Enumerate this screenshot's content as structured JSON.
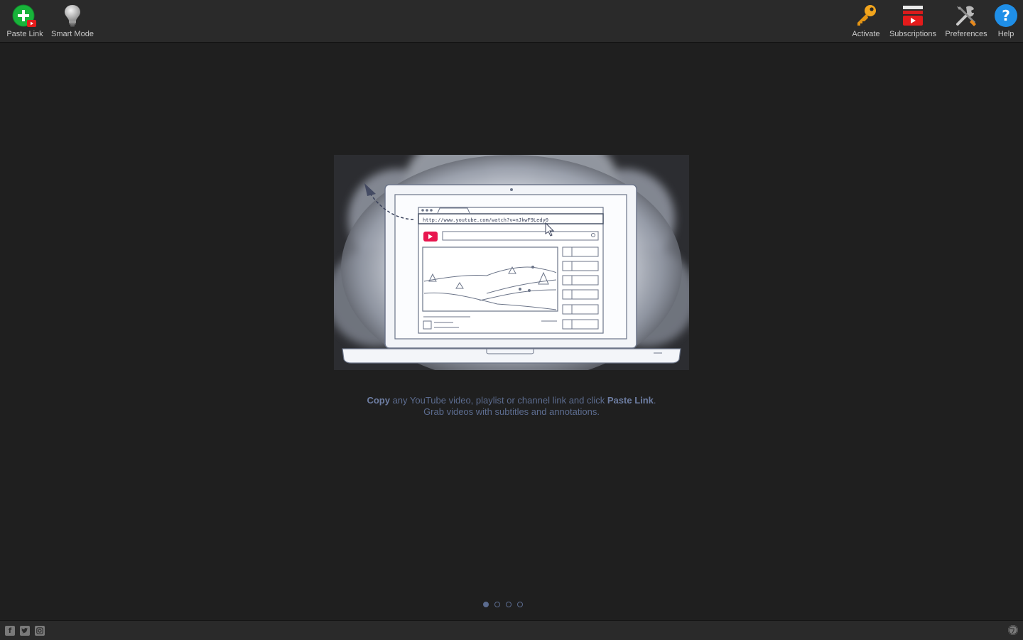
{
  "toolbar": {
    "left": [
      {
        "id": "paste-link",
        "label": "Paste Link",
        "icon": "paste-link-icon"
      },
      {
        "id": "smart-mode",
        "label": "Smart Mode",
        "icon": "lightbulb-icon"
      }
    ],
    "right": [
      {
        "id": "activate",
        "label": "Activate",
        "icon": "key-icon"
      },
      {
        "id": "subscriptions",
        "label": "Subscriptions",
        "icon": "subscriptions-icon"
      },
      {
        "id": "preferences",
        "label": "Preferences",
        "icon": "tools-icon"
      },
      {
        "id": "help",
        "label": "Help",
        "icon": "help-icon"
      }
    ]
  },
  "hero": {
    "url_text": "http://www.youtube.com/watch?v=nJkwF9Ledy0"
  },
  "caption": {
    "line1_bold_start": "Copy",
    "line1_middle": " any YouTube video, playlist or channel link and click ",
    "line1_bold_end": "Paste Link",
    "line1_end": ".",
    "line2": "Grab videos with subtitles and annotations."
  },
  "pager": {
    "count": 4,
    "active_index": 0
  },
  "bottombar": {
    "social": [
      "facebook-icon",
      "twitter-icon",
      "instagram-icon"
    ],
    "right_icon": "globe-icon"
  },
  "colors": {
    "background": "#1f1f1f",
    "toolbar": "#2a2a2a",
    "caption": "#5c6c8f",
    "youtube_red": "#e8164f"
  }
}
